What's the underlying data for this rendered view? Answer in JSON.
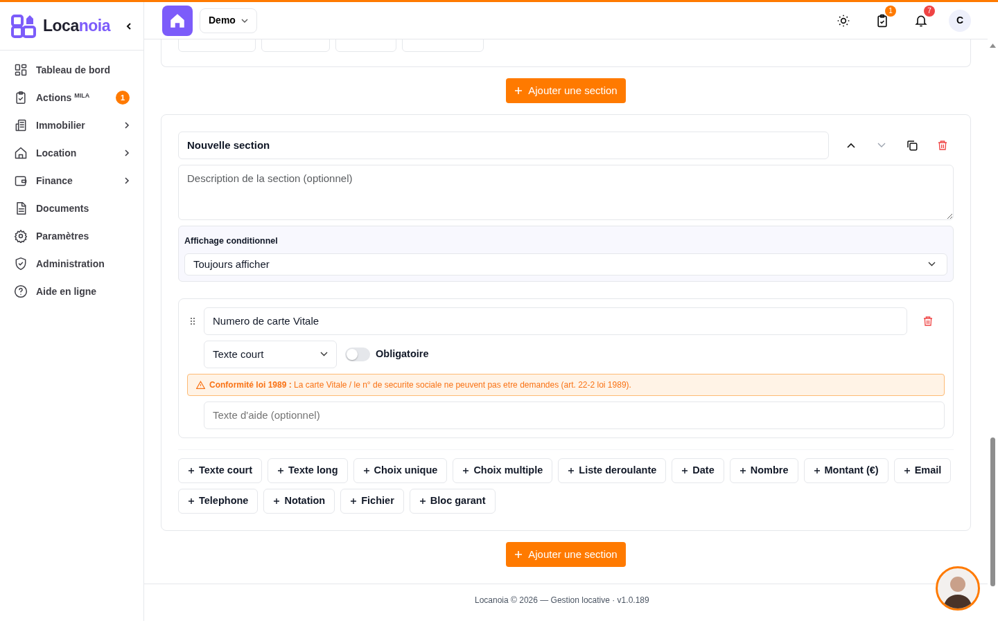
{
  "brand": {
    "prefix": "Loca",
    "suffix": "noia"
  },
  "sidebar": {
    "items": [
      {
        "label": "Tableau de bord",
        "expandable": false
      },
      {
        "label": "Actions $^{MILA}$",
        "expandable": false,
        "badge": "1"
      },
      {
        "label": "Immobilier",
        "expandable": true
      },
      {
        "label": "Location",
        "expandable": true
      },
      {
        "label": "Finance",
        "expandable": true
      },
      {
        "label": "Documents",
        "expandable": false
      },
      {
        "label": "Paramètres",
        "expandable": false
      },
      {
        "label": "Administration",
        "expandable": false
      },
      {
        "label": "Aide en ligne",
        "expandable": false
      }
    ]
  },
  "header": {
    "workspace": "Demo",
    "tasks_badge": "1",
    "notifications_badge": "7",
    "user_initial": "C"
  },
  "add_section_buttons": [
    "Ajouter une section",
    "Ajouter une section"
  ],
  "section": {
    "title": "Nouvelle section",
    "can_move_up": true,
    "can_move_down": false,
    "description_placeholder": "Description de la section (optionnel)",
    "conditional": {
      "label": "Affichage conditionnel",
      "value": "Toujours afficher"
    },
    "fields": [
      {
        "label": "Numero de carte Vitale",
        "type": "Texte court",
        "required": false,
        "required_label": "Obligatoire",
        "warning": "**Conformité loi 1989 :** La carte Vitale / le n° de securite sociale ne peuvent pas etre demandes (art. 22-2 loi 1989).",
        "help_placeholder": "Texte d'aide (optionnel)"
      }
    ],
    "add_buttons": [
      "Texte court",
      "Texte long",
      "Choix unique",
      "Choix multiple",
      "Liste deroulante",
      "Date",
      "Nombre",
      "Montant (€)",
      "Email",
      "Telephone",
      "Notation",
      "Fichier",
      "Bloc garant"
    ]
  },
  "footer": "Locanoia © 2026 — Gestion locative · v1.0.189"
}
